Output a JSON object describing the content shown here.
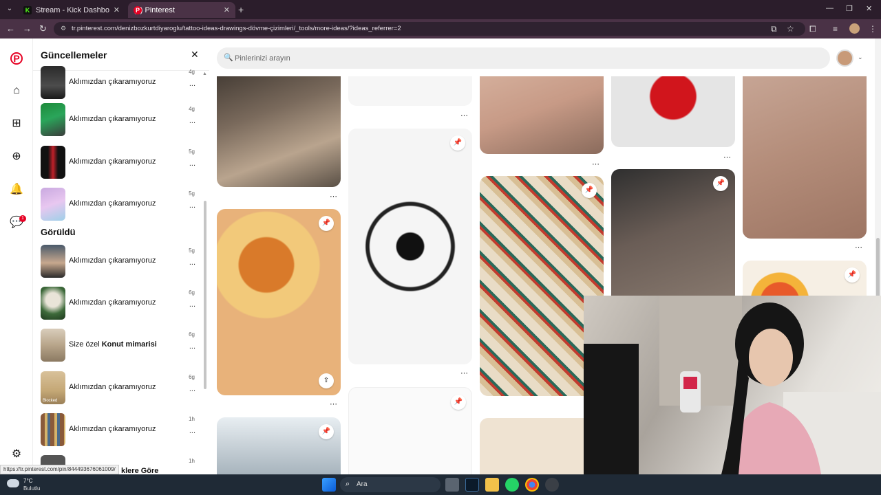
{
  "browser": {
    "tabs": [
      {
        "label": "Stream - Kick Dashboard",
        "favicon": "K"
      },
      {
        "label": "(1) Pinterest",
        "favicon": "P"
      }
    ],
    "url": "tr.pinterest.com/denizbozkurtdiyaroglu/tattoo-ideas-drawings-dövme-çizimleri/_tools/more-ideas/?ideas_referrer=2",
    "status_url": "https://tr.pinterest.com/pin/844493676061009/"
  },
  "panel": {
    "title": "Güncellemeler",
    "section_seen": "Görüldü",
    "items_new": [
      {
        "text": "Aklımızdan çıkaramıyoruz",
        "time": "4g"
      },
      {
        "text": "Aklımızdan çıkaramıyoruz",
        "time": "4g"
      },
      {
        "text": "Aklımızdan çıkaramıyoruz",
        "time": "5g"
      },
      {
        "text": "Aklımızdan çıkaramıyoruz",
        "time": "5g"
      }
    ],
    "items_seen": [
      {
        "text": "Aklımızdan çıkaramıyoruz",
        "time": "5g"
      },
      {
        "text": "Aklımızdan çıkaramıyoruz",
        "time": "6g"
      },
      {
        "text_prefix": "Size özel ",
        "text_bold": "Konut mimarisi",
        "time": "6g"
      },
      {
        "text": "Aklımızdan çıkaramıyoruz",
        "time": "6g",
        "thumb_label": "Blocked"
      },
      {
        "text": "Aklımızdan çıkaramıyoruz",
        "time": "1h"
      },
      {
        "text_tail": "klere Göre",
        "time": "1h"
      }
    ],
    "more_glyph": "..."
  },
  "search": {
    "placeholder": "Pinlerinizi arayın"
  },
  "rail": {
    "notification_count": "1"
  },
  "taskbar": {
    "temperature": "7°C",
    "weather": "Bulutlu",
    "search_label": "Ara"
  },
  "colors": {
    "pinterest_red": "#e60023",
    "browser_dark": "#2b1d2b",
    "taskbar": "#1f2a36"
  }
}
